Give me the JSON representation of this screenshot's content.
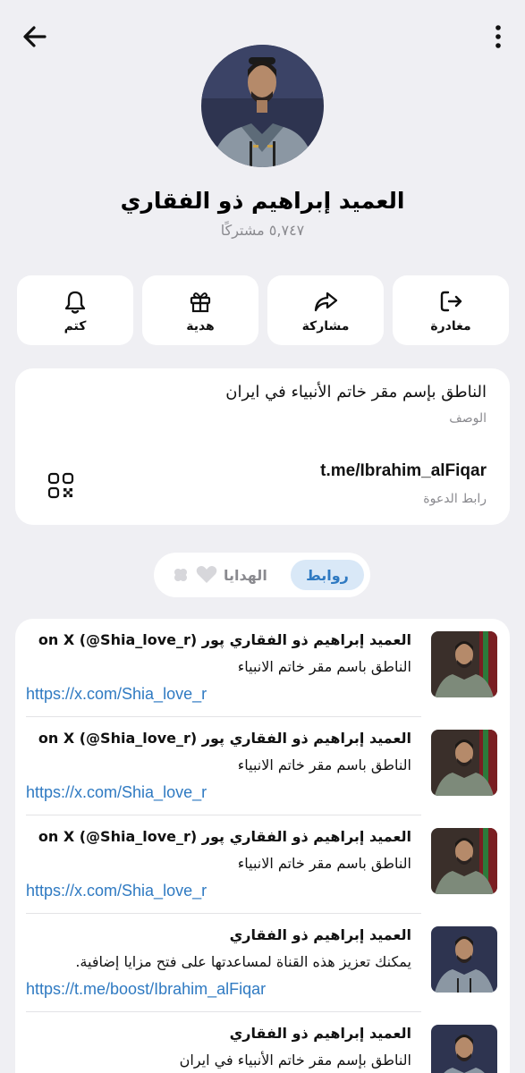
{
  "header": {
    "back_icon": "arrow-left-icon",
    "menu_icon": "more-vertical-icon"
  },
  "channel": {
    "name": "العميد إبراهيم ذو الفقاري",
    "subscribers": "٥,٧٤٧ مشتركًا"
  },
  "actions": [
    {
      "label": "مغادرة",
      "icon": "leave-icon"
    },
    {
      "label": "مشاركة",
      "icon": "share-icon"
    },
    {
      "label": "هدية",
      "icon": "gift-icon"
    },
    {
      "label": "كتم",
      "icon": "bell-icon"
    }
  ],
  "info": {
    "description": "الناطق بإسم مقر خاتم الأنبياء في ايران",
    "description_label": "الوصف",
    "invite_link": "t.me/Ibrahim_alFiqar",
    "invite_label": "رابط الدعوة"
  },
  "tabs": {
    "links": "روابط",
    "gifts": "الهدايا"
  },
  "links": [
    {
      "title": "العميد إبراهيم ذو الفقاري پور (‎@Shia_love_r) on X",
      "description": "الناطق باسم مقر خاتم الانبياء",
      "url": "https://x.com/Shia_love_r"
    },
    {
      "title": "العميد إبراهيم ذو الفقاري پور (‎@Shia_love_r) on X",
      "description": "الناطق باسم مقر خاتم الانبياء",
      "url": "https://x.com/Shia_love_r"
    },
    {
      "title": "العميد إبراهيم ذو الفقاري پور (‎@Shia_love_r) on X",
      "description": "الناطق باسم مقر خاتم الانبياء",
      "url": "https://x.com/Shia_love_r"
    },
    {
      "title": "العميد إبراهيم ذو الفقاري",
      "description": "يمكنك تعزيز هذه القناة لمساعدتها على فتح مزايا إضافية.",
      "url": "https://t.me/boost/Ibrahim_alFiqar"
    },
    {
      "title": "العميد إبراهيم ذو الفقاري",
      "description": "الناطق بإسم مقر خاتم الأنبياء في ايران",
      "url": ""
    }
  ],
  "colors": {
    "background": "#efeff3",
    "accent": "#2f7ac2",
    "tab_highlight": "#d9e8f7"
  }
}
